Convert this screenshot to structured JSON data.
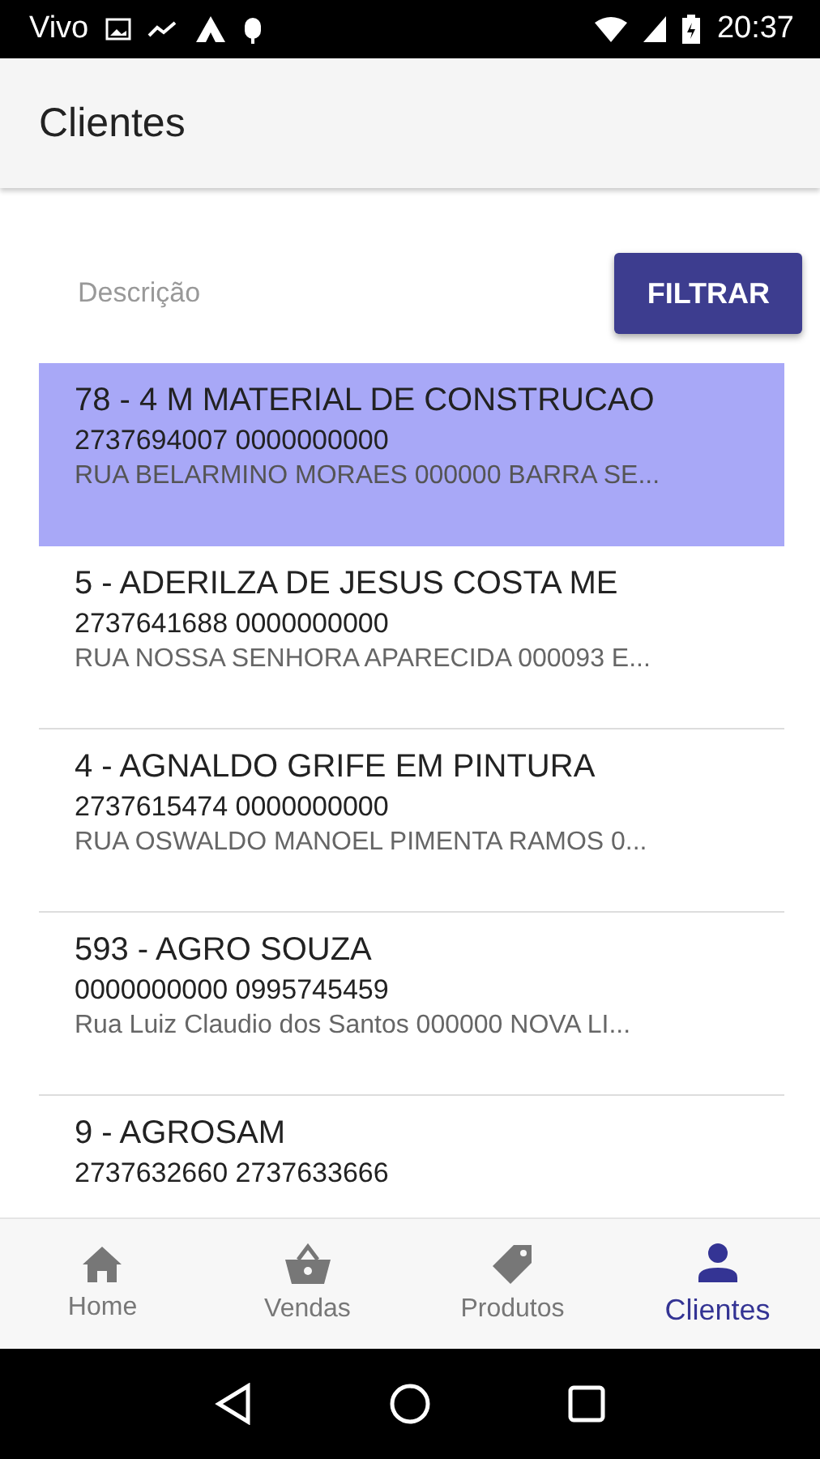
{
  "status_bar": {
    "carrier": "Vivo",
    "time": "20:37"
  },
  "app_bar": {
    "title": "Clientes"
  },
  "filter": {
    "placeholder": "Descrição",
    "button": "FILTRAR"
  },
  "clients": [
    {
      "name": "78 - 4 M MATERIAL DE CONSTRUCAO",
      "phones": "2737694007 0000000000",
      "address": "RUA BELARMINO MORAES 000000 BARRA SE...",
      "selected": true
    },
    {
      "name": "5 - ADERILZA DE JESUS COSTA ME",
      "phones": "2737641688 0000000000",
      "address": "RUA NOSSA SENHORA APARECIDA 000093 E...",
      "selected": false
    },
    {
      "name": "4 - AGNALDO GRIFE EM PINTURA",
      "phones": "2737615474 0000000000",
      "address": "RUA OSWALDO MANOEL PIMENTA RAMOS 0...",
      "selected": false
    },
    {
      "name": "593 - AGRO SOUZA",
      "phones": "0000000000 0995745459",
      "address": "Rua Luiz Claudio dos Santos 000000 NOVA LI...",
      "selected": false
    },
    {
      "name": "9 - AGROSAM",
      "phones": "2737632660 2737633666",
      "selected": false
    }
  ],
  "bottom_nav": [
    {
      "label": "Home",
      "kind": "home",
      "selected": false
    },
    {
      "label": "Vendas",
      "kind": "basket",
      "selected": false
    },
    {
      "label": "Produtos",
      "kind": "tag",
      "selected": false
    },
    {
      "label": "Clientes",
      "kind": "person",
      "selected": true
    }
  ]
}
